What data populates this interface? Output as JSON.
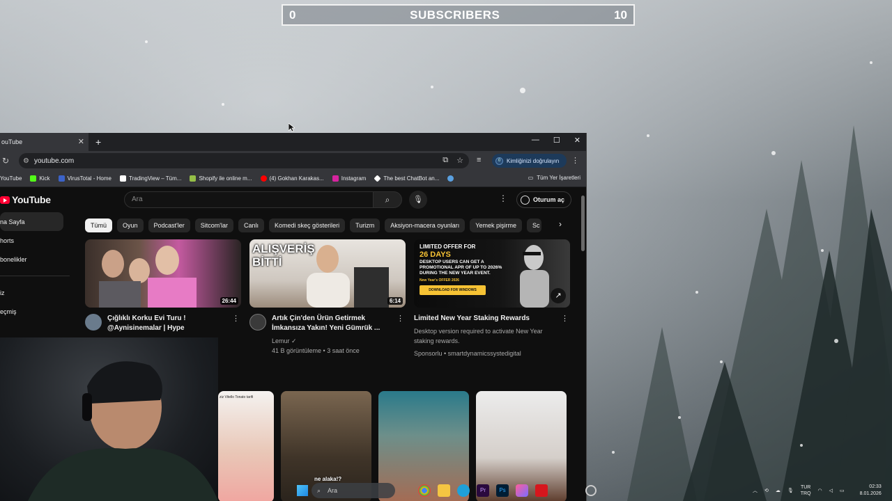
{
  "overlay": {
    "counter_left": "0",
    "counter_title": "SUBSCRIBERS",
    "counter_right": "10"
  },
  "browser": {
    "tab_title": "ouTube",
    "address": "youtube.com",
    "verify_label": "Kimliğinizi doğrulayın",
    "verify_badge": "0",
    "bookmarks": [
      {
        "label": "YouTube",
        "color": "#ff0000"
      },
      {
        "label": "Kick",
        "color": "#53fc18"
      },
      {
        "label": "VirusTotal - Home",
        "color": "#3c63c8"
      },
      {
        "label": "TradingView – Tüm...",
        "color": "#ffffff"
      },
      {
        "label": "Shopify ile online m...",
        "color": "#95bf47"
      },
      {
        "label": "(4) Gokhan Karakas...",
        "color": "#ff0000"
      },
      {
        "label": "Instagram",
        "color": "#d6249f"
      },
      {
        "label": "The best ChatBot an...",
        "color": "#ffffff"
      }
    ],
    "all_bookmarks": "Tüm Yer İşaretleri"
  },
  "youtube": {
    "logo_text": "YouTube",
    "search_placeholder": "Ara",
    "signin_label": "Oturum aç",
    "sidebar": [
      {
        "label": "na Sayfa",
        "active": true
      },
      {
        "label": "horts",
        "active": false
      },
      {
        "label": "bonelikler",
        "active": false
      },
      {
        "label": "iz",
        "active": false
      },
      {
        "label": "eçmiş",
        "active": false
      }
    ],
    "chips": [
      "Tümü",
      "Oyun",
      "Podcast'ler",
      "Sitcom'lar",
      "Canlı",
      "Komedi skeç gösterileri",
      "Turizm",
      "Aksiyon-macera oyunları",
      "Yemek pişirme",
      "Sc"
    ],
    "videos": [
      {
        "title": "Çığlıklı Korku Evi Turu ! @Aynisinemalar | Hype",
        "channel": "",
        "stats": "",
        "duration": "26:44",
        "avatar_color": "#6a7b8c"
      },
      {
        "title": "Artık Çin'den Ürün Getirmek İmkansıza Yakın! Yeni Gümrük ...",
        "channel": "Lemur ✓",
        "stats": "41 B görüntüleme • 3 saat önce",
        "duration": "6:14",
        "thumb_text": "ALIŞVERİŞ BİTTİ",
        "avatar_color": "#3a3a3a"
      },
      {
        "title": "Limited New Year Staking Rewards",
        "channel": "Desktop version required to activate New Year staking rewards.",
        "stats": "Sponsorlu • smartdynamicssystedigital",
        "duration": "",
        "ad_lines": [
          "LIMITED OFFER FOR",
          "26 DAYS",
          "DESKTOP USERS CAN GET A PROMOTIONAL APR OF UP TO 2026%",
          "DURING THE NEW YEAR EVENT.",
          "New Year's OFFER 2026",
          "DOWNLOAD FOR WINDOWS"
        ]
      }
    ],
    "shorts_captions": [
      "ziz Vitello Tonato tarifi",
      "ne alaka!?",
      "",
      ""
    ]
  },
  "taskbar": {
    "search_label": "Ara",
    "lang_top": "TUR",
    "lang_bottom": "TRQ",
    "time": "02:33",
    "date": "8.01.2026"
  }
}
